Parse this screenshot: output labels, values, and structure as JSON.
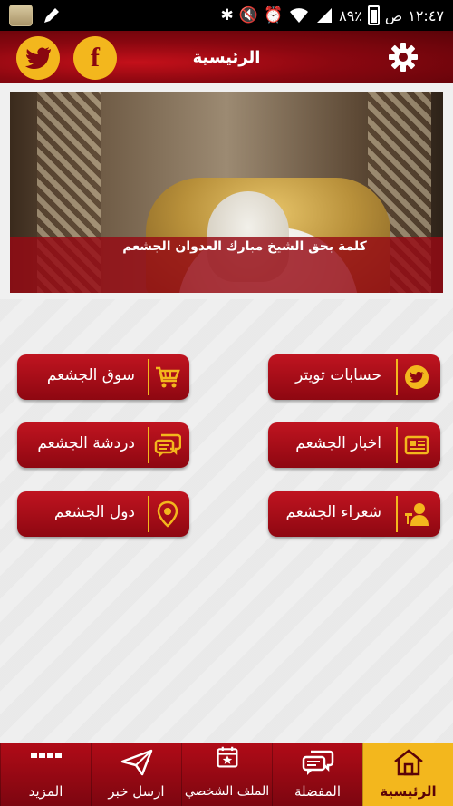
{
  "status_bar": {
    "time": "١٢:٤٧",
    "ampm": "ص",
    "battery": "٨٩٪"
  },
  "header": {
    "title": "الرئيسية",
    "facebook_glyph": "f",
    "twitter_icon": "twitter-icon",
    "settings_icon": "gear-icon"
  },
  "banner": {
    "caption": "كلمة بحق الشيخ مبارك العدوان الجشعم"
  },
  "menu": {
    "items": [
      {
        "label": "حسابات تويتر",
        "icon": "twitter-icon"
      },
      {
        "label": "سوق الجشعم",
        "icon": "cart-icon"
      },
      {
        "label": "اخبار الجشعم",
        "icon": "newspaper-icon"
      },
      {
        "label": "دردشة الجشعم",
        "icon": "chat-icon"
      },
      {
        "label": "شعراء الجشعم",
        "icon": "poet-icon"
      },
      {
        "label": "دول الجشعم",
        "icon": "location-pin-icon"
      }
    ]
  },
  "bottom_nav": {
    "items": [
      {
        "label": "الرئيسية",
        "icon": "home-icon",
        "active": true
      },
      {
        "label": "المفضلة",
        "icon": "chat-bubbles-icon",
        "active": false
      },
      {
        "label": "الملف الشخصي",
        "icon": "calendar-star-icon",
        "active": false
      },
      {
        "label": "ارسل خبر",
        "icon": "paper-plane-icon",
        "active": false
      },
      {
        "label": "المزيد",
        "icon": "grid-dots-icon",
        "active": false
      }
    ]
  },
  "colors": {
    "primary_red": "#a00913",
    "accent_gold": "#f3b71d"
  }
}
